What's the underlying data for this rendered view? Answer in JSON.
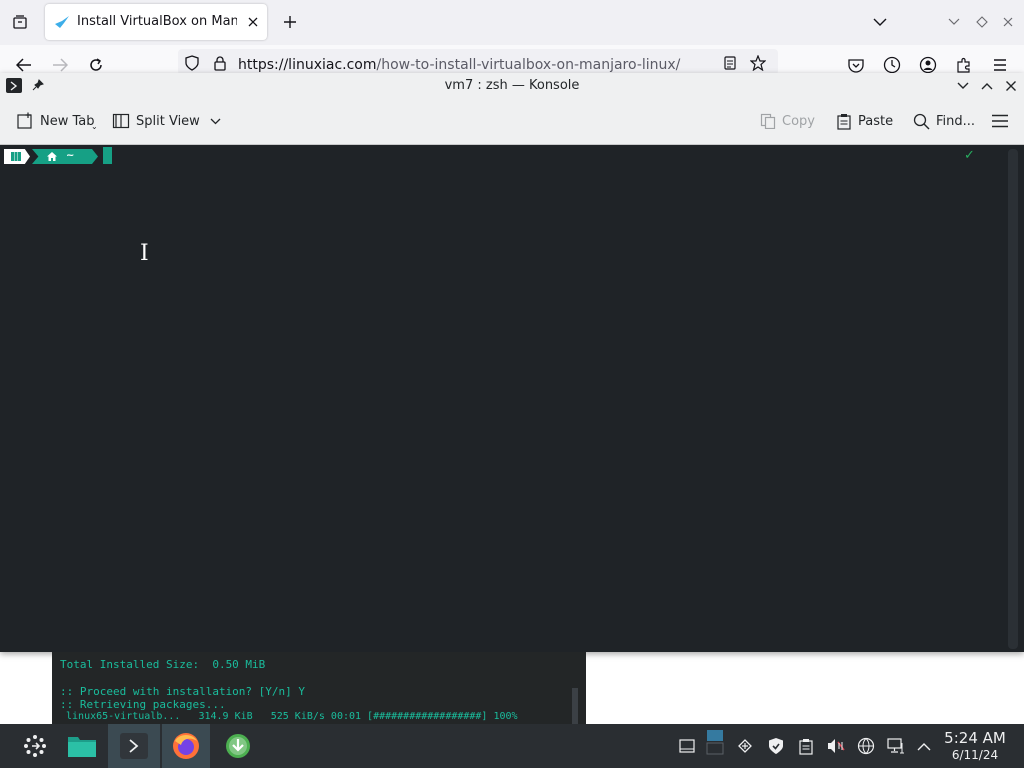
{
  "browser": {
    "tab_title": "Install VirtualBox on Manj",
    "url_host": "https://linuxiac.com",
    "url_path": "/how-to-install-virtualbox-on-manjaro-linux/"
  },
  "konsole": {
    "window_title": "vm7 : zsh — Konsole",
    "toolbar": {
      "new_tab": "New Tab",
      "split_view": "Split View",
      "copy": "Copy",
      "paste": "Paste",
      "find": "Find..."
    },
    "prompt": {
      "path": "~",
      "status": "✓"
    }
  },
  "background_terminal": {
    "lines": [
      "Total Installed Size:  0.50 MiB",
      ":: Proceed with installation? [Y/n] Y",
      ":: Retrieving packages...",
      " linux65-virtualb...   314.9 KiB   525 KiB/s 00:01 [##################] 100%"
    ]
  },
  "taskbar": {
    "time": "5:24 AM",
    "date": "6/11/24"
  },
  "colors": {
    "terminal_bg": "#1f2327",
    "accent_teal": "#16a085",
    "taskbar_bg": "#2a2e32"
  }
}
